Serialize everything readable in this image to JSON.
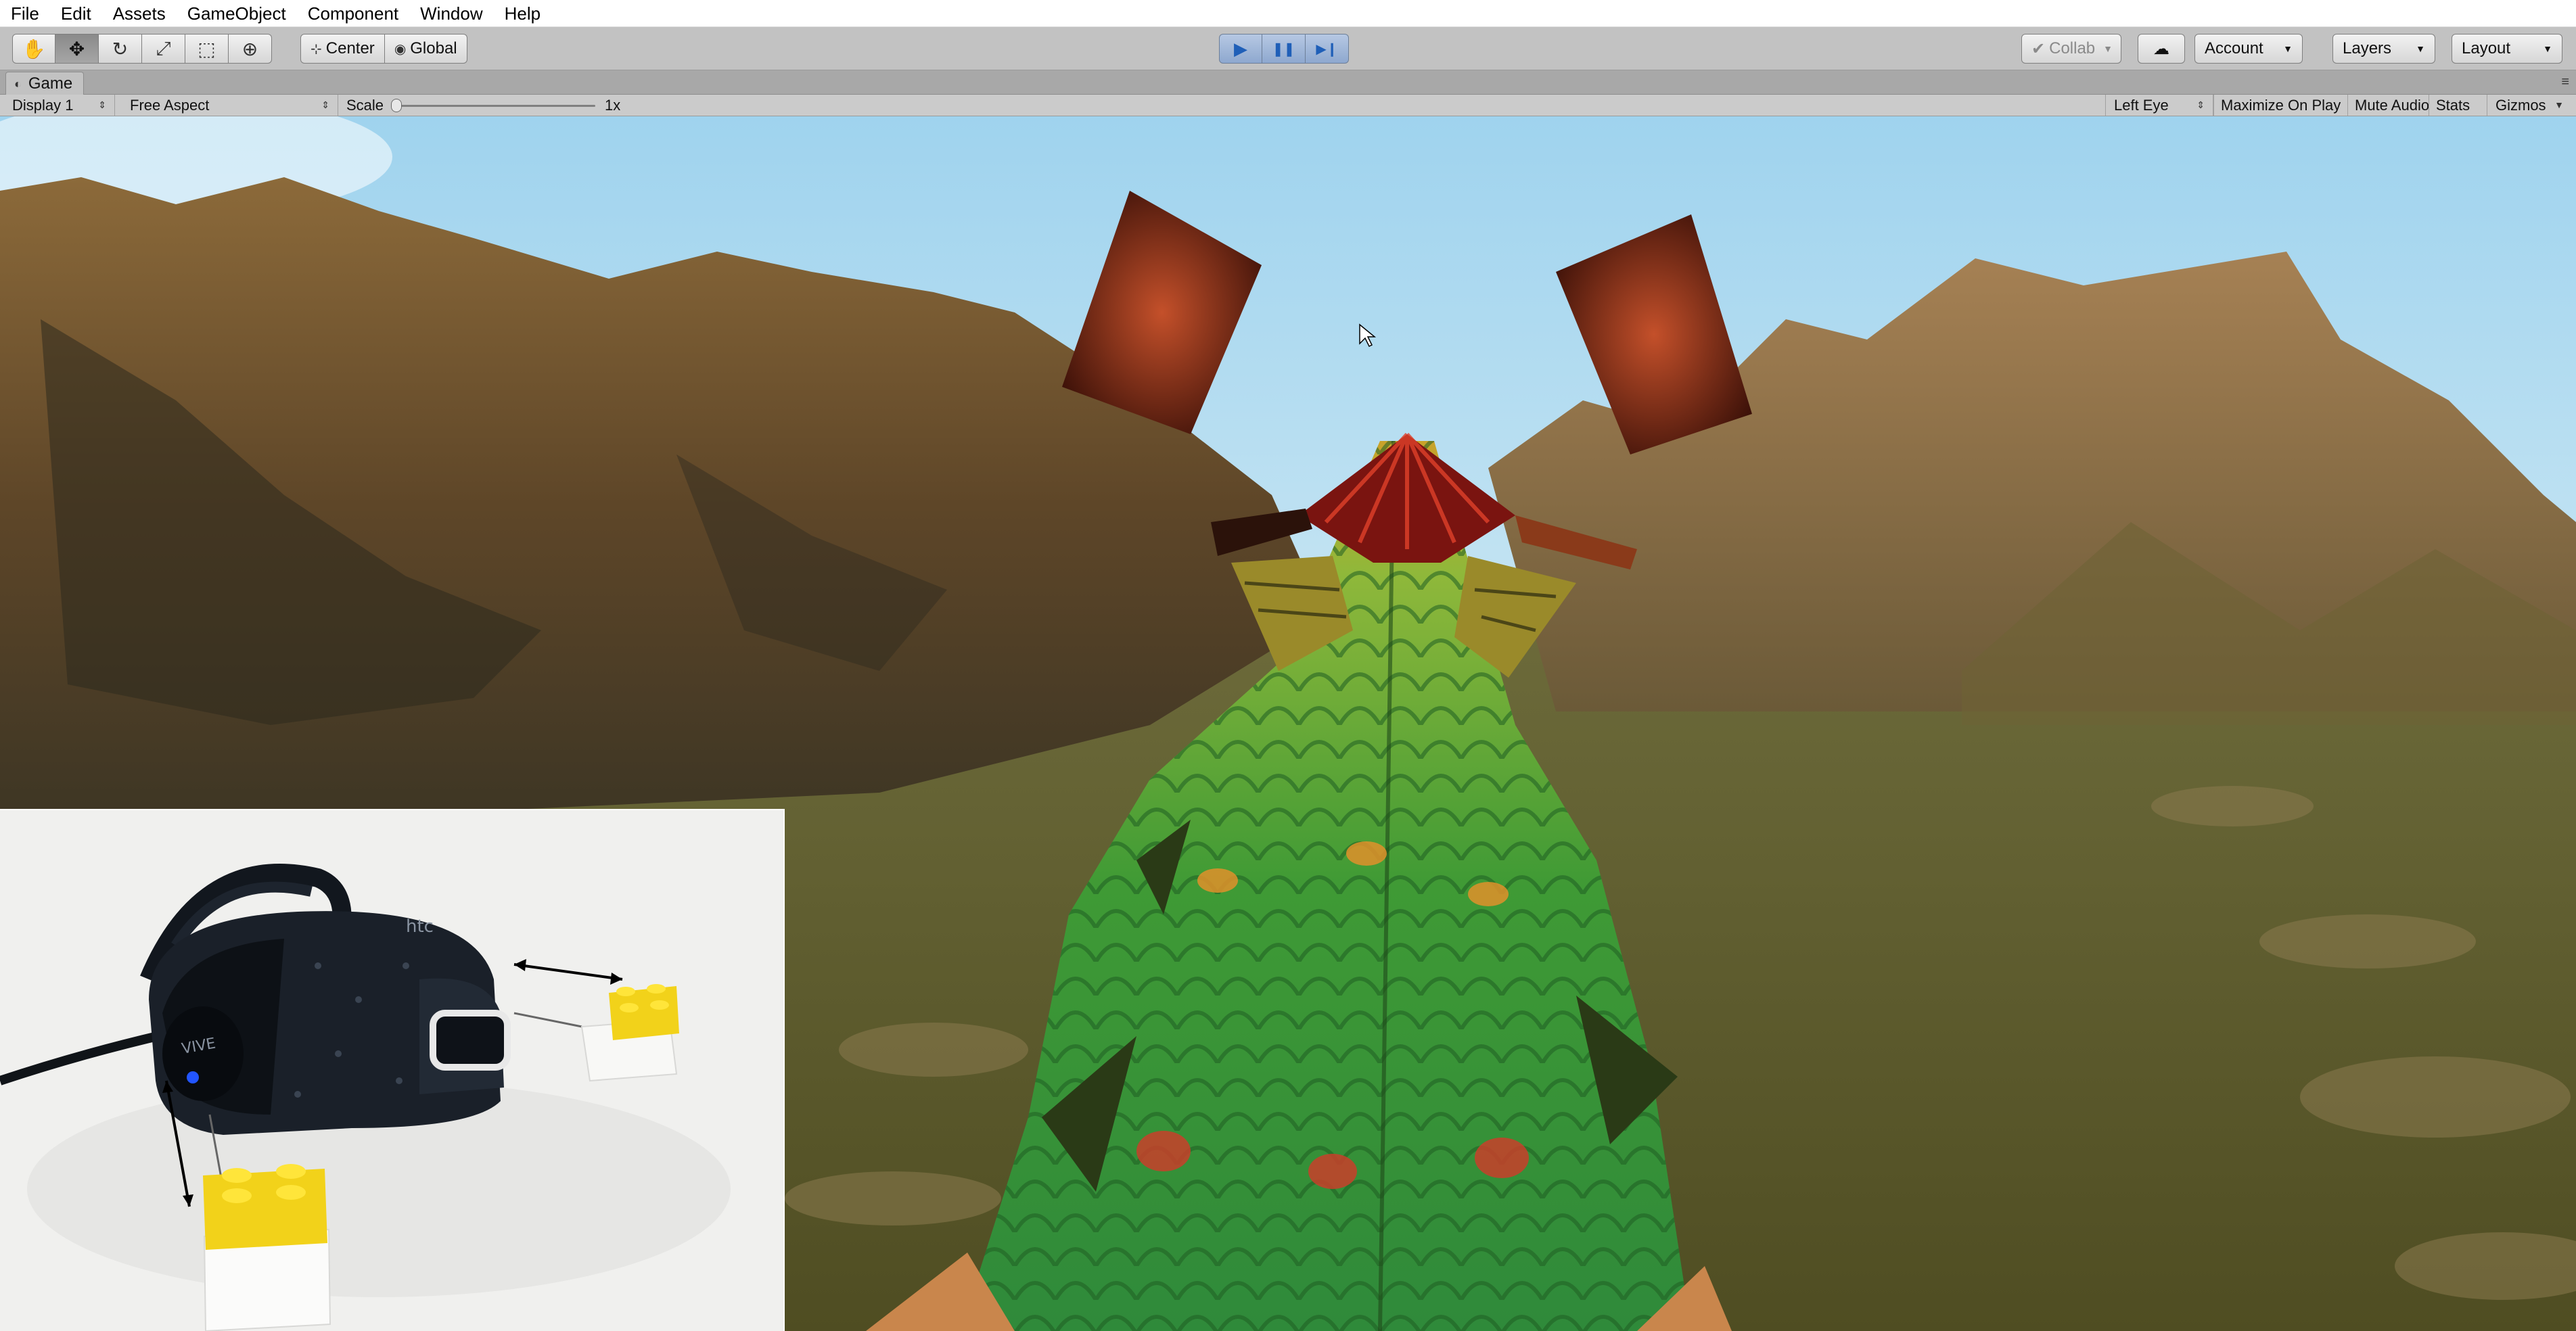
{
  "menubar": {
    "items": [
      "File",
      "Edit",
      "Assets",
      "GameObject",
      "Component",
      "Window",
      "Help"
    ]
  },
  "toolbar": {
    "tools": [
      {
        "name": "hand-tool",
        "icon": "hand-icon",
        "glyph": "✋",
        "active": false
      },
      {
        "name": "move-tool",
        "icon": "move-arrows-icon",
        "glyph": "✥",
        "active": true
      },
      {
        "name": "rotate-tool",
        "icon": "rotate-icon",
        "glyph": "↻",
        "active": false
      },
      {
        "name": "scale-tool",
        "icon": "scale-icon",
        "glyph": "⤢",
        "active": false
      },
      {
        "name": "rect-tool",
        "icon": "rect-tool-icon",
        "glyph": "⬚",
        "active": false
      },
      {
        "name": "transform-tool",
        "icon": "transform-icon",
        "glyph": "⊕",
        "active": false
      }
    ],
    "pivot_label": "Center",
    "rotation_label": "Global",
    "play_controls": [
      {
        "name": "play-button",
        "icon": "play-icon",
        "glyph": "▶"
      },
      {
        "name": "pause-button",
        "icon": "pause-icon",
        "glyph": "❚❚"
      },
      {
        "name": "step-button",
        "icon": "step-icon",
        "glyph": "▶❙"
      }
    ],
    "collab_label": "Collab",
    "account_label": "Account",
    "layers_label": "Layers",
    "layout_label": "Layout"
  },
  "game_panel": {
    "tab_label": "Game",
    "display_label": "Display 1",
    "aspect_label": "Free Aspect",
    "scale_label": "Scale",
    "scale_value": "1x",
    "eye_label": "Left Eye",
    "maximize_label": "Maximize On Play",
    "mute_label": "Mute Audio",
    "stats_label": "Stats",
    "gizmos_label": "Gizmos"
  },
  "inset_photo": {
    "headset_brand": "htc",
    "headset_model": "VIVE"
  },
  "colors": {
    "play_accent": "#1f5fb8",
    "editor_gray": "#c2c2c2",
    "sky": "#b9dff2",
    "grass": "#5e5a2c",
    "mountain": "#7a5a32"
  }
}
